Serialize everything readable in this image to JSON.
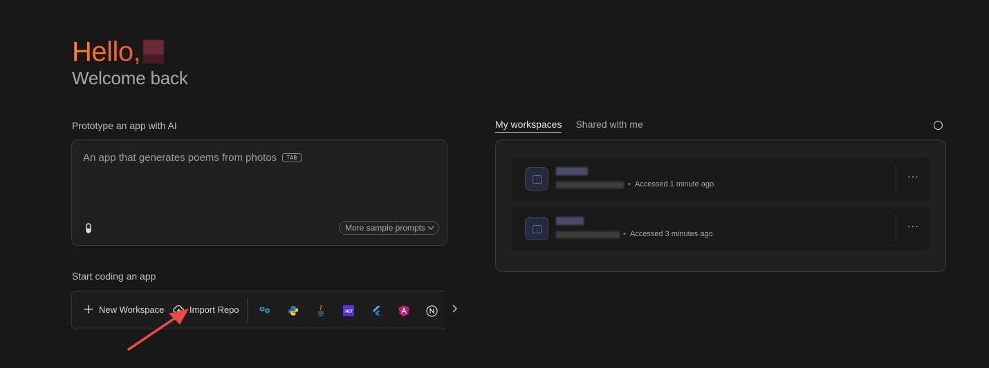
{
  "greeting": {
    "hello": "Hello,",
    "subtitle": "Welcome back"
  },
  "prototype": {
    "label": "Prototype an app with AI",
    "placeholder": "An app that generates poems from photos",
    "tab_hint": "TAB",
    "more_prompts_label": "More sample prompts"
  },
  "start_coding": {
    "label": "Start coding an app",
    "new_workspace_label": "New Workspace",
    "import_repo_label": "Import Repo",
    "templates": [
      {
        "name": "go-icon",
        "glyph": "∞",
        "color": "#22a7c9"
      },
      {
        "name": "python-icon",
        "glyph": "",
        "color": "#3b78b0"
      },
      {
        "name": "java-icon",
        "glyph": "☕",
        "color": "#e27024"
      },
      {
        "name": "dotnet-icon",
        "glyph": ".NET",
        "color": "#5a2ed0"
      },
      {
        "name": "flutter-icon",
        "glyph": "",
        "color": "#4aa9ea"
      },
      {
        "name": "angular-icon",
        "glyph": "A",
        "color": "#c8197a"
      },
      {
        "name": "nextjs-icon",
        "glyph": "N",
        "color": "#e6e6e6"
      }
    ]
  },
  "workspaces": {
    "tabs": [
      {
        "label": "My workspaces",
        "active": true
      },
      {
        "label": "Shared with me",
        "active": false
      }
    ],
    "items": [
      {
        "accessed": "Accessed 1 minute ago"
      },
      {
        "accessed": "Accessed 3 minutes ago"
      }
    ]
  },
  "colors": {
    "background": "#181818",
    "accent_gradient_start": "#ff8a1e",
    "accent_gradient_end": "#e9552e",
    "annotation_arrow": "#ec4a4a"
  }
}
